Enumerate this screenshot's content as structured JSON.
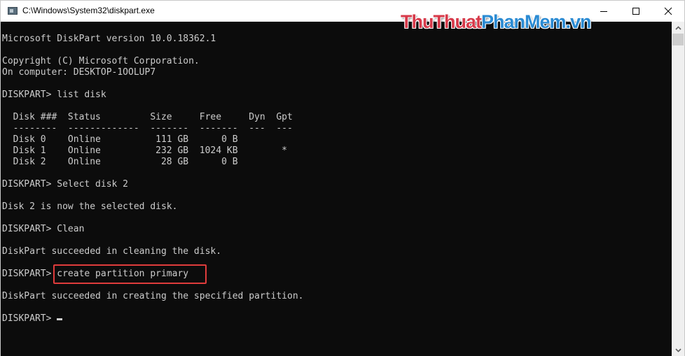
{
  "window": {
    "title": "C:\\Windows\\System32\\diskpart.exe",
    "controls": {
      "minimize": "minimize-icon",
      "maximize": "maximize-icon",
      "close": "close-icon"
    }
  },
  "watermark": {
    "part1": "ThuThuat",
    "part2": "PhanMem.vn"
  },
  "console": {
    "lines": [
      "Microsoft DiskPart version 10.0.18362.1",
      "",
      "Copyright (C) Microsoft Corporation.",
      "On computer: DESKTOP-1OOLUP7",
      "",
      "DISKPART> list disk",
      "",
      "  Disk ###  Status         Size     Free     Dyn  Gpt",
      "  --------  -------------  -------  -------  ---  ---",
      "  Disk 0    Online          111 GB      0 B",
      "  Disk 1    Online          232 GB  1024 KB        *",
      "  Disk 2    Online           28 GB      0 B",
      "",
      "DISKPART> Select disk 2",
      "",
      "Disk 2 is now the selected disk.",
      "",
      "DISKPART> Clean",
      "",
      "DiskPart succeeded in cleaning the disk.",
      "",
      "DISKPART> create partition primary",
      "",
      "DiskPart succeeded in creating the specified partition.",
      "",
      "DISKPART> "
    ],
    "highlighted_command": "create partition primary",
    "highlight_color": "#e03c3c",
    "background_color": "#0c0c0c",
    "text_color": "#cccccc"
  },
  "disk_table": {
    "headers": [
      "Disk ###",
      "Status",
      "Size",
      "Free",
      "Dyn",
      "Gpt"
    ],
    "rows": [
      [
        "Disk 0",
        "Online",
        "111 GB",
        "0 B",
        "",
        ""
      ],
      [
        "Disk 1",
        "Online",
        "232 GB",
        "1024 KB",
        "",
        "*"
      ],
      [
        "Disk 2",
        "Online",
        "28 GB",
        "0 B",
        "",
        ""
      ]
    ]
  }
}
